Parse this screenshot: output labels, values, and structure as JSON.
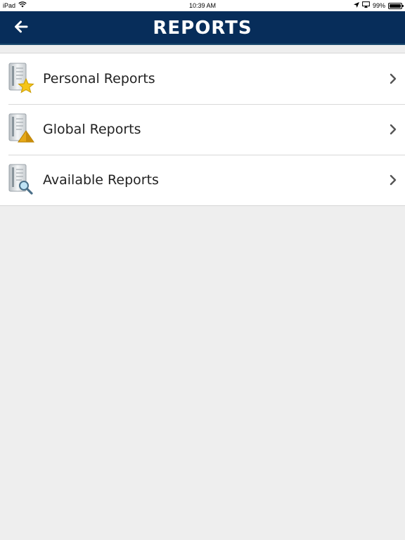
{
  "status_bar": {
    "device": "iPad",
    "time": "10:39 AM",
    "battery": "99%",
    "battery_level": 0.99
  },
  "header": {
    "title": "REPORTS",
    "back_icon": "arrow-left-icon"
  },
  "reports": {
    "items": [
      {
        "label": "Personal Reports",
        "icon": "report-star-icon"
      },
      {
        "label": "Global Reports",
        "icon": "report-pyramid-icon"
      },
      {
        "label": "Available Reports",
        "icon": "report-search-icon"
      }
    ],
    "chevron_icon": "chevron-right-icon"
  },
  "colors": {
    "header_bg": "#072d5a",
    "page_bg": "#eeeeee",
    "list_bg": "#ffffff"
  }
}
